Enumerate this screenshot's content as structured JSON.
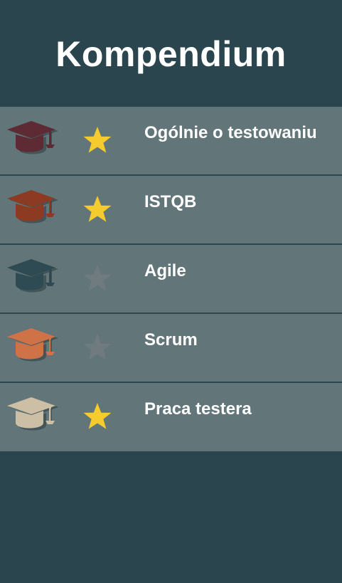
{
  "app": {
    "title": "Kompendium"
  },
  "colors": {
    "background": "#2a454d",
    "row_background": "#627579",
    "star_active": "#f6cb2d",
    "star_inactive": "#6f7b7e"
  },
  "courses": [
    {
      "label": "Ogólnie o testowaniu",
      "cap_color": "#5e2a34",
      "favorite": true,
      "icon": "graduation-cap-icon"
    },
    {
      "label": "ISTQB",
      "cap_color": "#8c3a22",
      "favorite": true,
      "icon": "graduation-cap-icon"
    },
    {
      "label": "Agile",
      "cap_color": "#2e4a52",
      "favorite": false,
      "icon": "graduation-cap-icon"
    },
    {
      "label": "Scrum",
      "cap_color": "#cf7248",
      "favorite": false,
      "icon": "graduation-cap-icon"
    },
    {
      "label": "Praca testera",
      "cap_color": "#cdbfa5",
      "favorite": true,
      "icon": "graduation-cap-icon"
    }
  ]
}
